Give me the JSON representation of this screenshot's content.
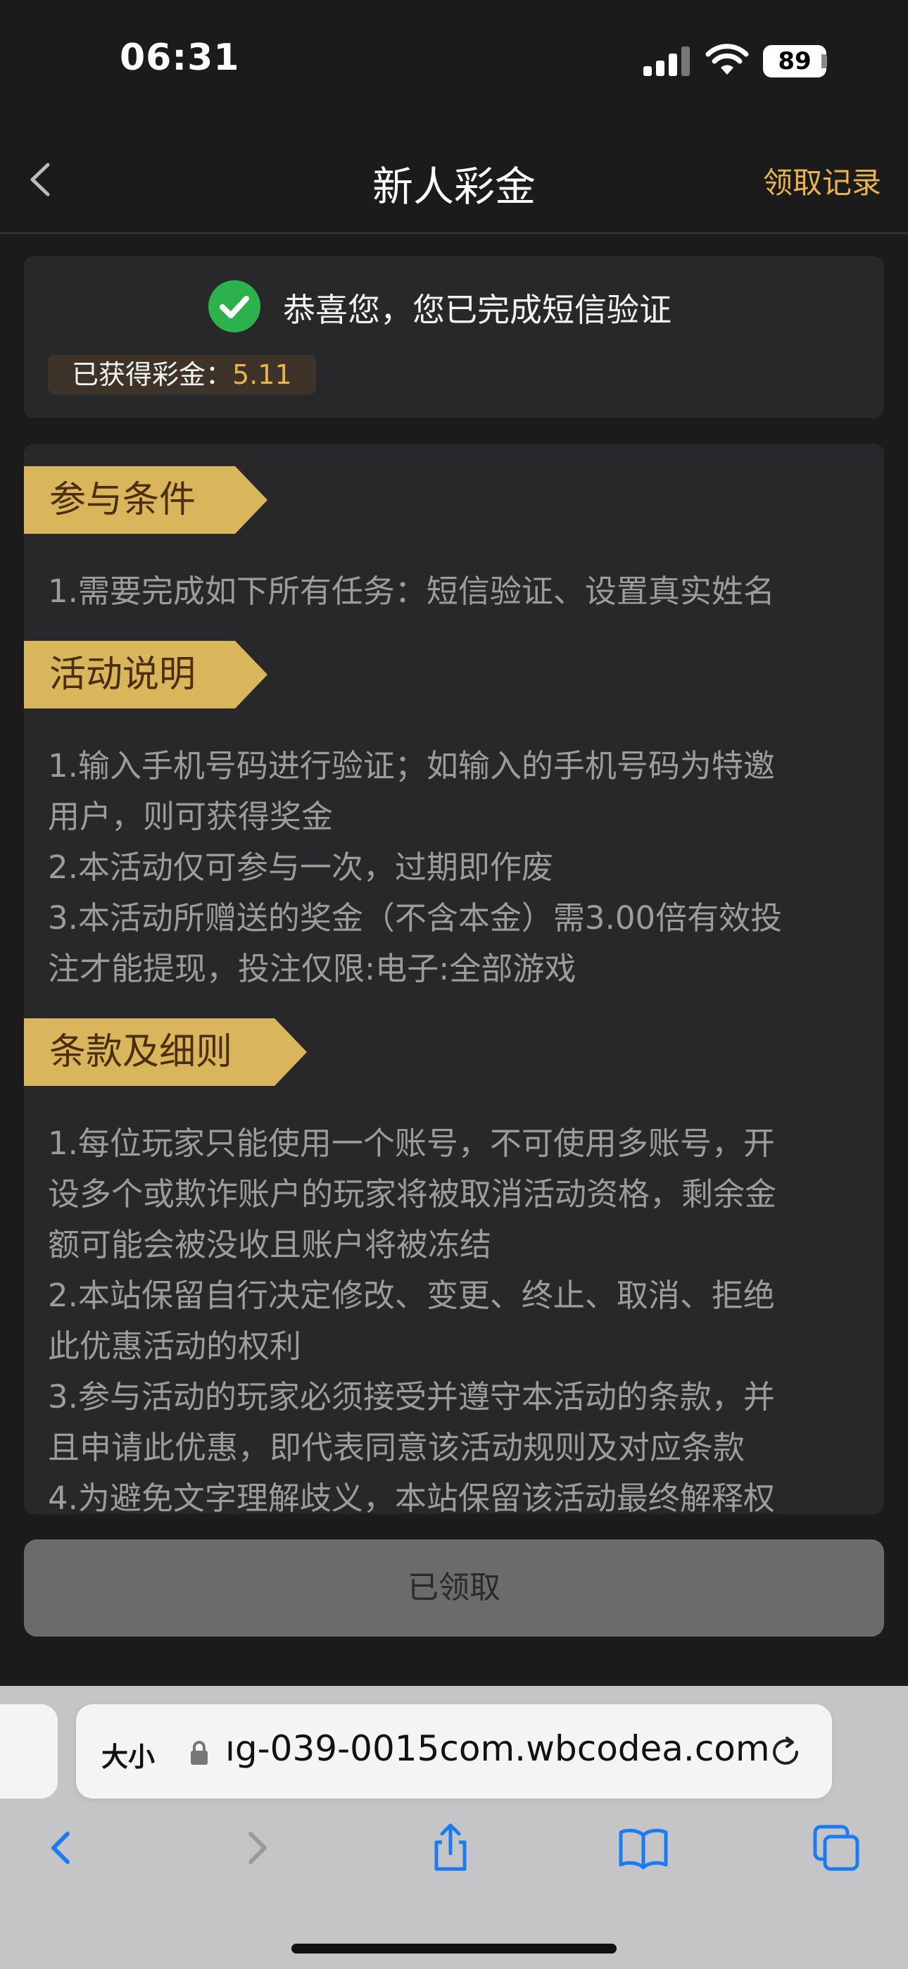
{
  "status": {
    "time": "06:31",
    "battery": "89"
  },
  "nav": {
    "title": "新人彩金",
    "right": "领取记录"
  },
  "notice": {
    "message": "恭喜您，您已完成短信验证",
    "bonus_label": "已获得彩金：",
    "bonus_value": "5.11"
  },
  "sections": {
    "conditions": {
      "title": "参与条件",
      "lines": [
        "1.需要完成如下所有任务：短信验证、设置真实姓名"
      ]
    },
    "description": {
      "title": "活动说明",
      "lines": [
        "1.输入手机号码进行验证；如输入的手机号码为特邀",
        "用户，则可获得奖金",
        "2.本活动仅可参与一次，过期即作废",
        "3.本活动所赠送的奖金（不含本金）需3.00倍有效投",
        "注才能提现，投注仅限:电子:全部游戏"
      ]
    },
    "terms": {
      "title": "条款及细则",
      "lines": [
        "1.每位玩家只能使用一个账号，不可使用多账号，开",
        "设多个或欺诈账户的玩家将被取消活动资格，剩余金",
        "额可能会被没收且账户将被冻结",
        "2.本站保留自行决定修改、变更、终止、取消、拒绝",
        "此优惠活动的权利",
        "3.参与活动的玩家必须接受并遵守本活动的条款，并",
        "且申请此优惠，即代表同意该活动规则及对应条款",
        "4.为避免文字理解歧义，本站保留该活动最终解释权"
      ]
    }
  },
  "claim_button": "已领取",
  "browser": {
    "aa_label": "大小",
    "url": "ıg-039-0015com.wbcodea.com"
  },
  "colors": {
    "accent": "#e9b54a",
    "tag": "#d9b65b",
    "check": "#2bb24c"
  }
}
